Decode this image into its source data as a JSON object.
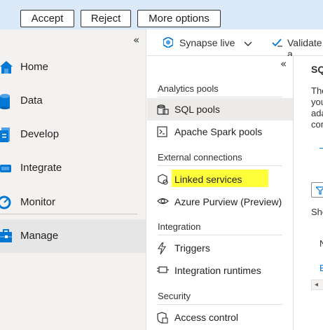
{
  "banner": {
    "accept": "Accept",
    "reject": "Reject",
    "more": "More options"
  },
  "leftnav": {
    "items": [
      {
        "label": "Home",
        "icon": "home-icon"
      },
      {
        "label": "Data",
        "icon": "database-icon"
      },
      {
        "label": "Develop",
        "icon": "document-icon"
      },
      {
        "label": "Integrate",
        "icon": "pipeline-icon"
      },
      {
        "label": "Monitor",
        "icon": "gauge-icon"
      },
      {
        "label": "Manage",
        "icon": "toolbox-icon"
      }
    ],
    "active": "Manage"
  },
  "toolbar": {
    "mode": "Synapse live",
    "validate": "Validate a"
  },
  "submenu": {
    "sections": [
      {
        "title": "Analytics pools",
        "items": [
          "SQL pools",
          "Apache Spark pools"
        ]
      },
      {
        "title": "External connections",
        "items": [
          "Linked services",
          "Azure Purview (Preview)"
        ]
      },
      {
        "title": "Integration",
        "items": [
          "Triggers",
          "Integration runtimes"
        ]
      },
      {
        "title": "Security",
        "items": [
          "Access control"
        ]
      }
    ],
    "selected": "SQL pools",
    "highlighted": "Linked services"
  },
  "right_pane": {
    "title": "SQ",
    "desc_lines": [
      "The",
      "you",
      "ada",
      "con"
    ],
    "show_text": "Sho",
    "col_header": "N",
    "row_text": "E"
  },
  "colors": {
    "banner_bg": "#dbe9f8",
    "highlight": "#ffff3a",
    "accent": "#0078d4"
  }
}
